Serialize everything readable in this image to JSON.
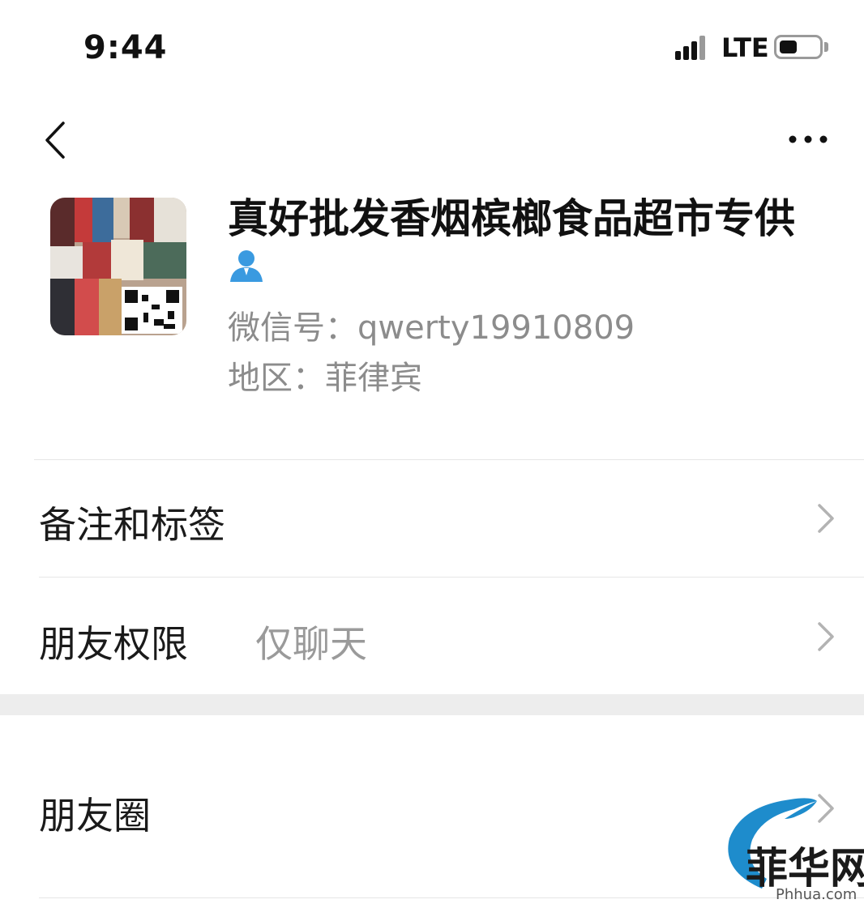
{
  "status_bar": {
    "time": "9:44",
    "network": "LTE",
    "battery_level": 0.45
  },
  "nav": {
    "back_icon": "chevron-left-icon",
    "more_icon": "more-horizontal-icon"
  },
  "profile": {
    "name": "真好批发香烟槟榔食品超市专供",
    "gender_icon": "person-icon",
    "gender_color": "#3a9ae0",
    "wechat_id": "微信号：qwerty19910809",
    "region": "地区：菲律宾"
  },
  "rows": [
    {
      "label": "备注和标签",
      "value": ""
    },
    {
      "label": "朋友权限",
      "value": "仅聊天"
    },
    {
      "label": "朋友圈",
      "value": ""
    }
  ],
  "watermark": {
    "cn": "菲华网",
    "site": "Phhua.com",
    "color": "#1e8ccc"
  }
}
